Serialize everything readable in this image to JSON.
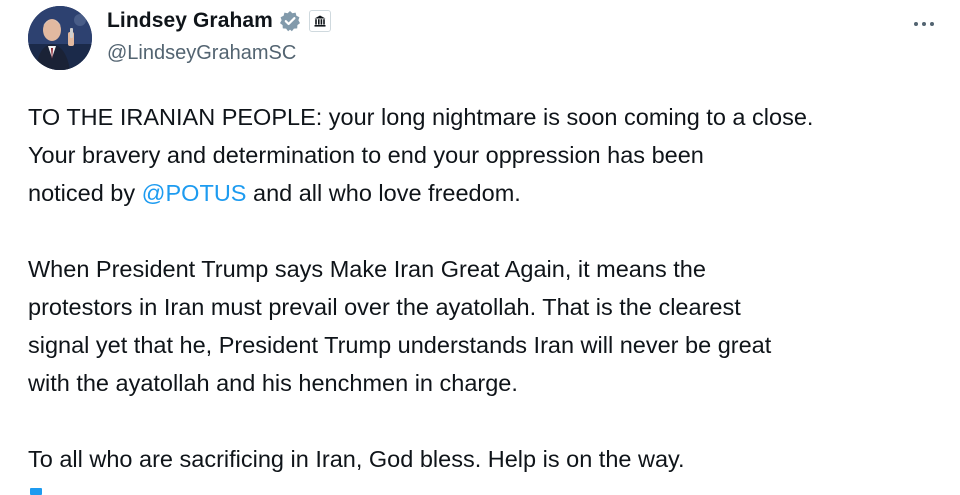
{
  "author": {
    "display_name": "Lindsey Graham",
    "handle": "@LindseyGrahamSC",
    "verified_color": "#829aab",
    "badge_icon": "government-building-icon"
  },
  "tweet": {
    "line1": "TO THE IRANIAN PEOPLE: your long nightmare is soon coming to a close.",
    "line2": "Your bravery and determination to end your oppression has been",
    "line3_before": "noticed by ",
    "line3_mention": "@POTUS",
    "line3_after": " and all who love freedom.",
    "line4": "When President Trump says Make Iran Great Again, it means the",
    "line5": "protestors in Iran must prevail over the ayatollah. That is the clearest",
    "line6": "signal yet that he, President Trump understands Iran will never be great",
    "line7": "with the ayatollah and his henchmen in charge.",
    "line8": "To all who are sacrificing in Iran, God bless. Help is on the way."
  },
  "colors": {
    "text": "#0f1419",
    "secondary": "#536471",
    "link": "#1d9bf0"
  },
  "icons": {
    "more": "more-horizontal-icon",
    "verified": "verified-badge-icon"
  }
}
